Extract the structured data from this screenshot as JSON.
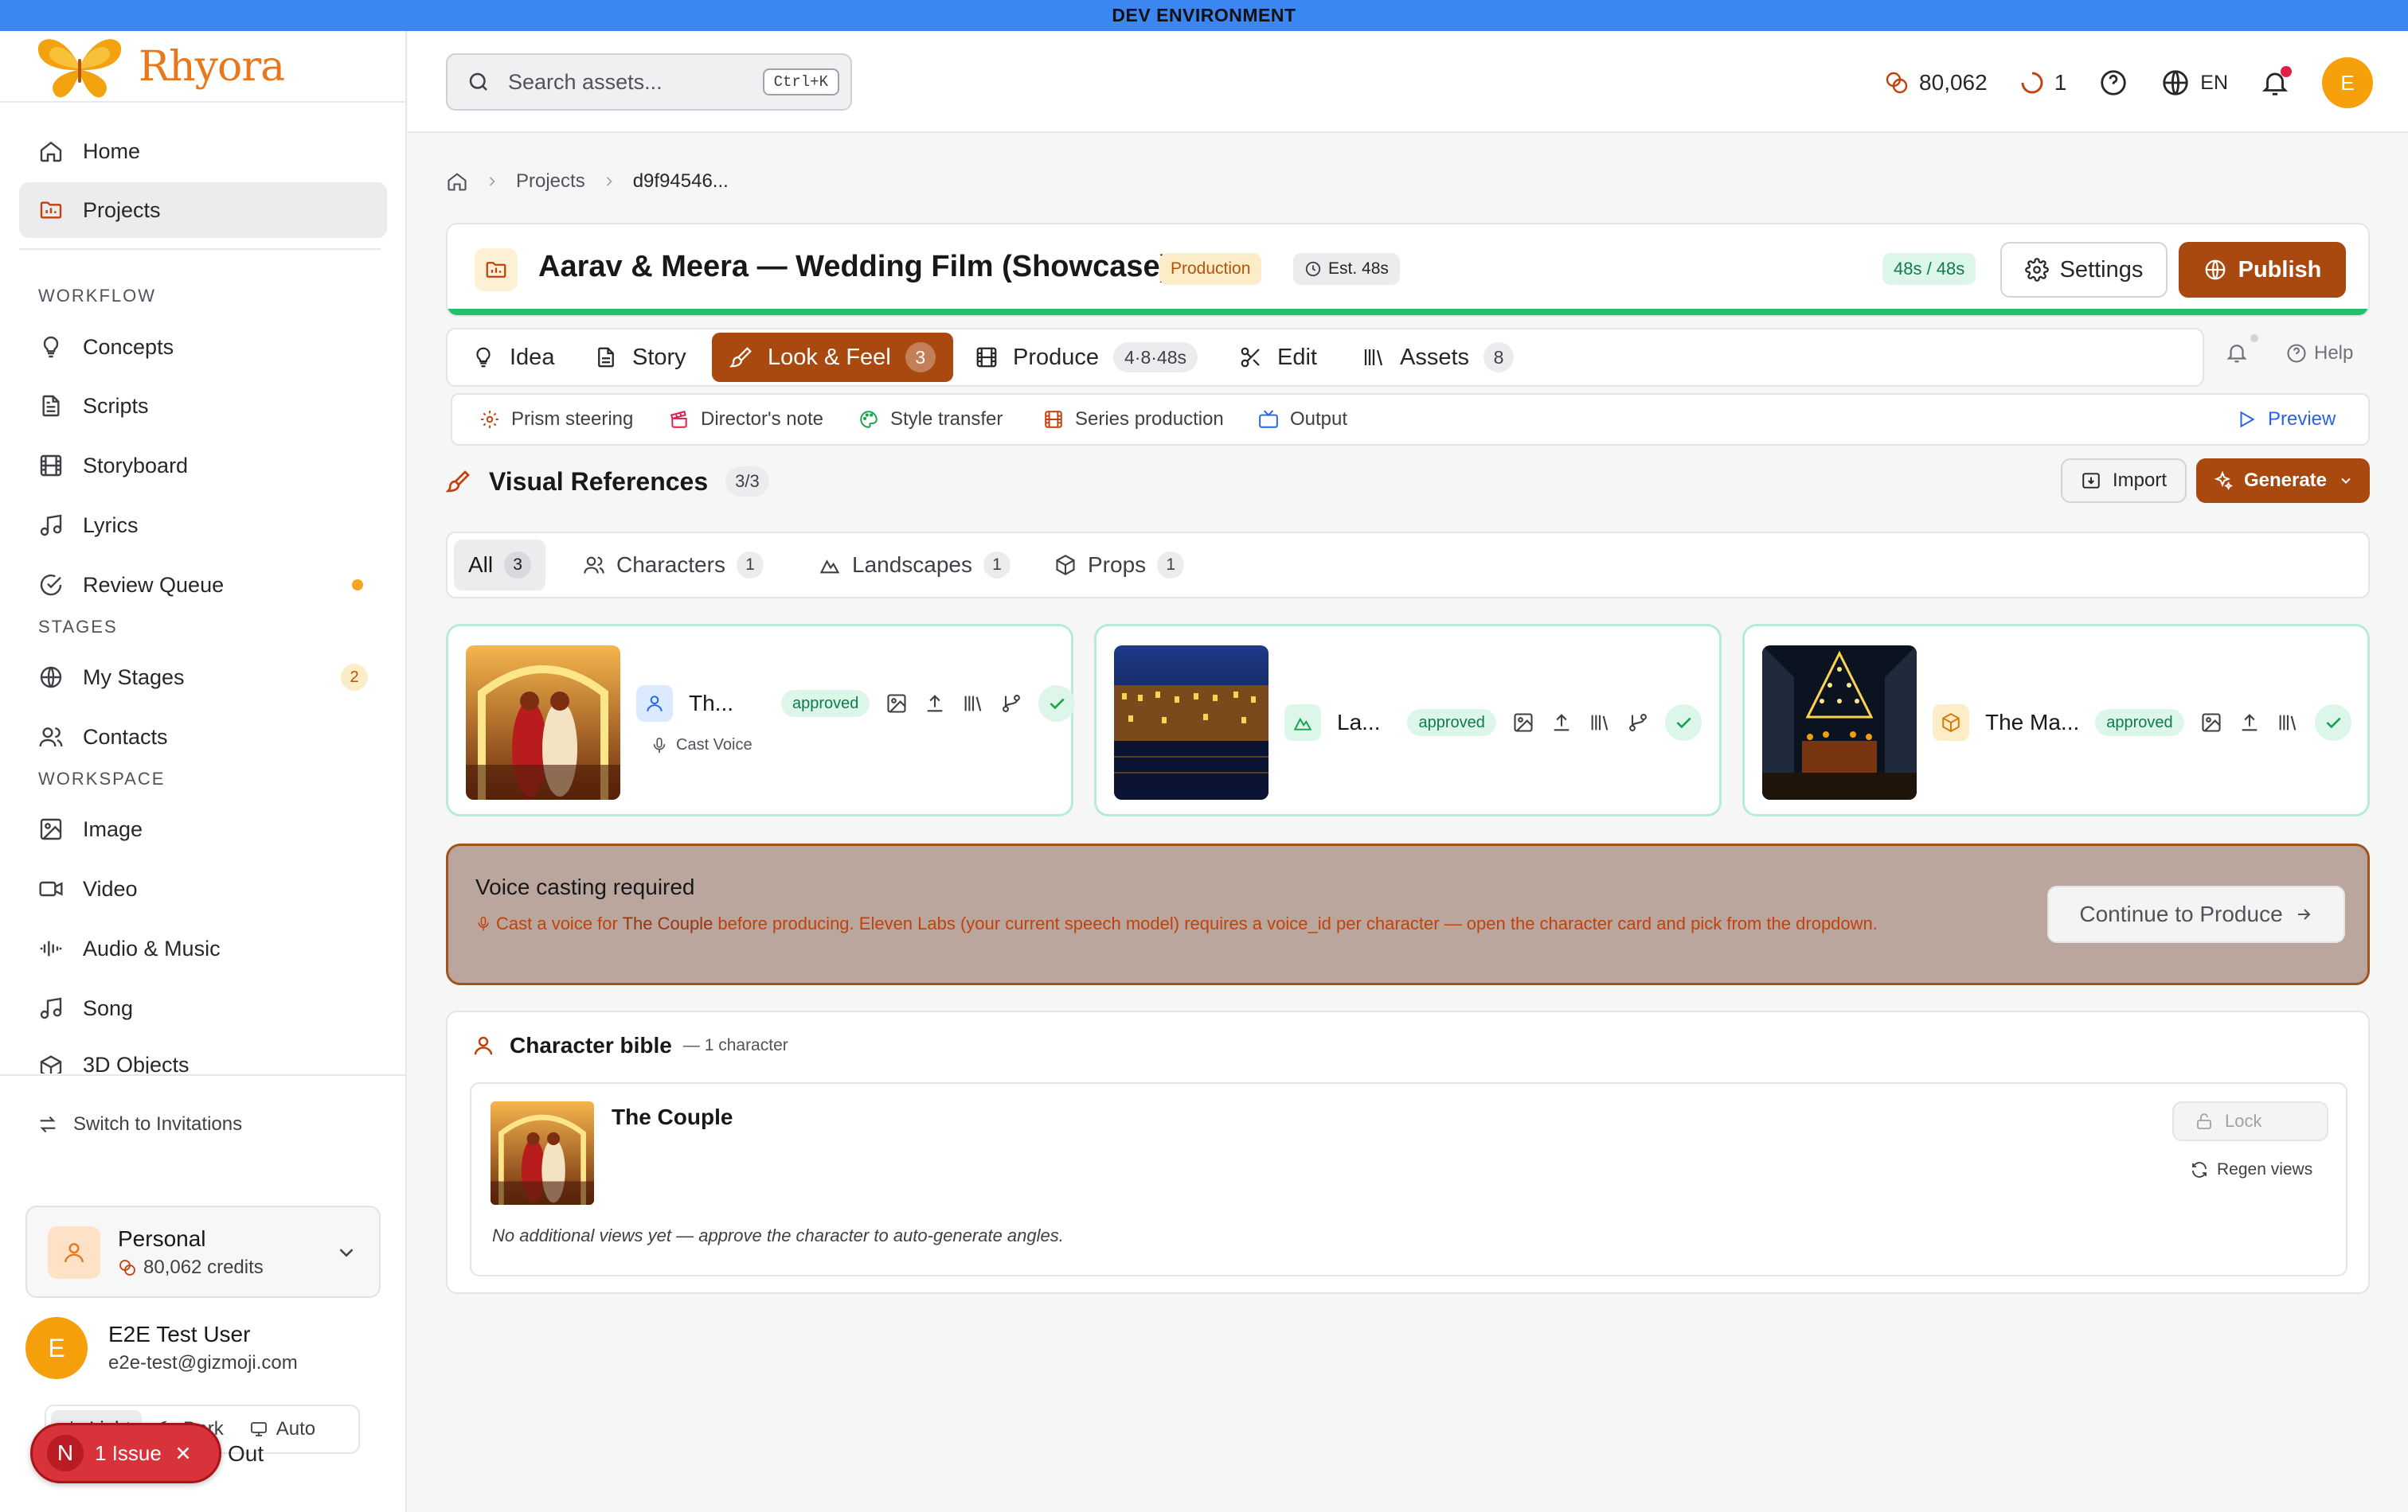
{
  "env_banner": "DEV ENVIRONMENT",
  "brand": {
    "name": "Rhyora",
    "accent": "#a94910"
  },
  "sidebar": {
    "home": "Home",
    "projects": "Projects",
    "workflow_label": "WORKFLOW",
    "workflow": [
      "Concepts",
      "Scripts",
      "Storyboard",
      "Lyrics",
      "Review Queue"
    ],
    "stages_label": "STAGES",
    "stages": [
      "My Stages",
      "Contacts"
    ],
    "my_stages_count": "2",
    "workspace_label": "WORKSPACE",
    "workspace": [
      "Image",
      "Video",
      "Audio & Music",
      "Song",
      "3D Objects"
    ],
    "switch_label": "Switch to Invitations",
    "account": {
      "name": "Personal",
      "credits": "80,062 credits"
    },
    "user": {
      "initial": "E",
      "name": "E2E Test User",
      "email": "e2e-test@gizmoji.com"
    },
    "theme": {
      "light": "Light",
      "dark": "Dark",
      "auto": "Auto"
    },
    "signout": "Sign Out",
    "signout_visible": "Out",
    "issue": {
      "letter": "N",
      "label": "1 Issue"
    }
  },
  "topbar": {
    "search_placeholder": "Search assets...",
    "shortcut": "Ctrl+K",
    "credits": "80,062",
    "jobs": "1",
    "lang": "EN",
    "avatar": "E"
  },
  "breadcrumb": {
    "projects": "Projects",
    "current": "d9f94546..."
  },
  "project": {
    "title": "Aarav & Meera — Wedding Film (Showcase)",
    "status": "Production",
    "estimate": "Est. 48s",
    "duration": "48s / 48s",
    "settings": "Settings",
    "publish": "Publish",
    "progress": 1.0
  },
  "tabs": [
    {
      "label": "Idea"
    },
    {
      "label": "Story"
    },
    {
      "label": "Look & Feel",
      "count": "3"
    },
    {
      "label": "Produce",
      "count": "4·8·48s"
    },
    {
      "label": "Edit"
    },
    {
      "label": "Assets",
      "count": "8"
    }
  ],
  "help": "Help",
  "subtabs": [
    "Prism steering",
    "Director's note",
    "Style transfer",
    "Series production",
    "Output"
  ],
  "preview": "Preview",
  "visual_refs": {
    "title": "Visual References",
    "count": "3/3",
    "import": "Import",
    "generate": "Generate"
  },
  "filters": [
    {
      "label": "All",
      "count": "3"
    },
    {
      "label": "Characters",
      "count": "1"
    },
    {
      "label": "Landscapes",
      "count": "1"
    },
    {
      "label": "Props",
      "count": "1"
    }
  ],
  "cards": [
    {
      "name": "Th...",
      "status": "approved",
      "sub": "Cast Voice"
    },
    {
      "name": "La...",
      "status": "approved"
    },
    {
      "name": "The Ma...",
      "status": "approved"
    }
  ],
  "voice": {
    "title": "Voice casting required",
    "msg_pre": "Cast a voice for ",
    "msg_name": "The Couple",
    "msg_post": " before producing. Eleven Labs (your current speech model) requires a voice_id per character — open the character card and pick from the dropdown.",
    "button": "Continue to Produce"
  },
  "bible": {
    "title": "Character bible",
    "count": "— 1 character",
    "name": "The Couple",
    "lock": "Lock",
    "regen": "Regen views",
    "note": "No additional views yet — approve the character to auto-generate angles."
  }
}
